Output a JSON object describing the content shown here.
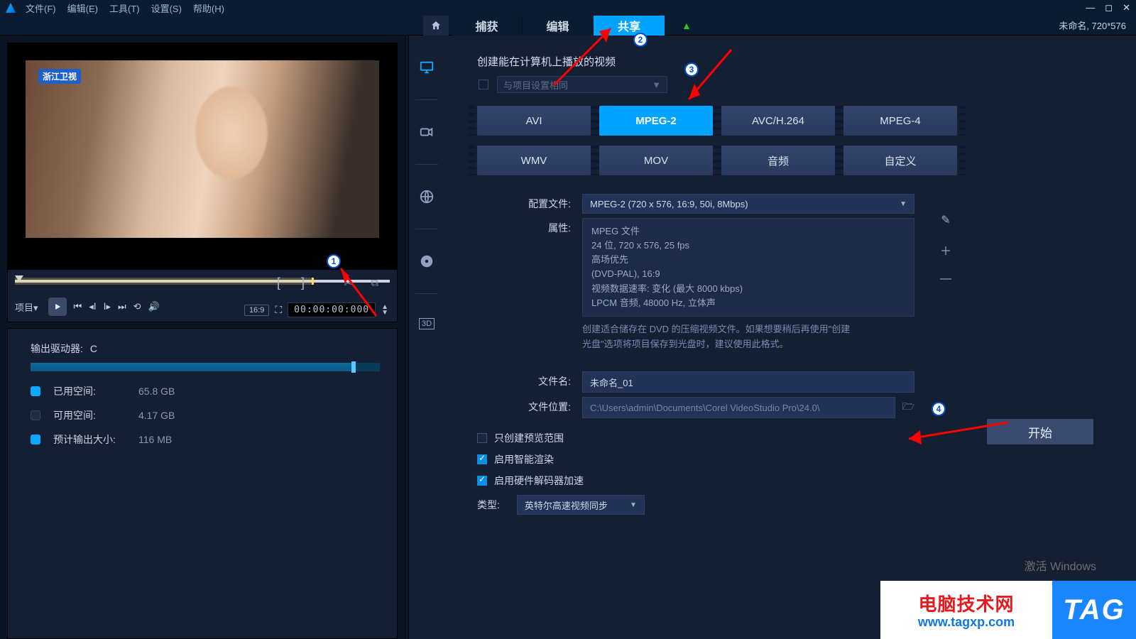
{
  "menu": {
    "items": [
      "文件(F)",
      "编辑(E)",
      "工具(T)",
      "设置(S)",
      "帮助(H)"
    ]
  },
  "window": {
    "status": "未命名, 720*576"
  },
  "steptabs": {
    "items": [
      "捕获",
      "编辑",
      "共享"
    ],
    "active_index": 2
  },
  "preview": {
    "channel_logo": "浙江卫视",
    "mode_label": "项目",
    "aspect_label": "16:9",
    "timecode": "00:00:00:000"
  },
  "drive": {
    "title": "输出驱动器:",
    "letter": "C",
    "used_label": "已用空间:",
    "used_value": "65.8 GB",
    "free_label": "可用空间:",
    "free_value": "4.17 GB",
    "est_label": "预计输出大小:",
    "est_value": "116 MB"
  },
  "typecol_items": [
    "computer",
    "camcorder",
    "web",
    "disc",
    "3d"
  ],
  "export": {
    "heading": "创建能在计算机上播放的视频",
    "same_as_project": "与项目设置相同",
    "formats": [
      {
        "label": "AVI"
      },
      {
        "label": "MPEG-2",
        "active": true
      },
      {
        "label": "AVC/H.264"
      },
      {
        "label": "MPEG-4"
      },
      {
        "label": "WMV"
      },
      {
        "label": "MOV"
      },
      {
        "label": "音频"
      },
      {
        "label": "自定义"
      }
    ],
    "profile_label": "配置文件:",
    "profile_value": "MPEG-2 (720 x 576, 16:9, 50i, 8Mbps)",
    "attr_label": "属性:",
    "attr_lines": [
      "MPEG 文件",
      "24 位, 720 x 576, 25 fps",
      "高场优先",
      "(DVD-PAL),  16:9",
      "视频数据速率: 变化 (最大  8000 kbps)",
      "LPCM 音频, 48000 Hz, 立体声"
    ],
    "description_a": "创建适合储存在 DVD 的压缩视频文件。如果想要稍后再使用\"创建",
    "description_b": "光盘\"选项将项目保存到光盘时，建议使用此格式。",
    "filename_label": "文件名:",
    "filename_value": "未命名_01",
    "location_label": "文件位置:",
    "location_value": "C:\\Users\\admin\\Documents\\Corel VideoStudio Pro\\24.0\\",
    "opt_preview_only": "只创建预览范围",
    "opt_smart_render": "启用智能渲染",
    "opt_hw_decode": "启用硬件解码器加速",
    "type_label": "类型:",
    "type_value": "英特尔高速视频同步",
    "start_label": "开始"
  },
  "watermark": {
    "line1": "电脑技术网",
    "line2": "www.tagxp.com",
    "tag": "TAG"
  },
  "activation_hint": "激活 Windows"
}
